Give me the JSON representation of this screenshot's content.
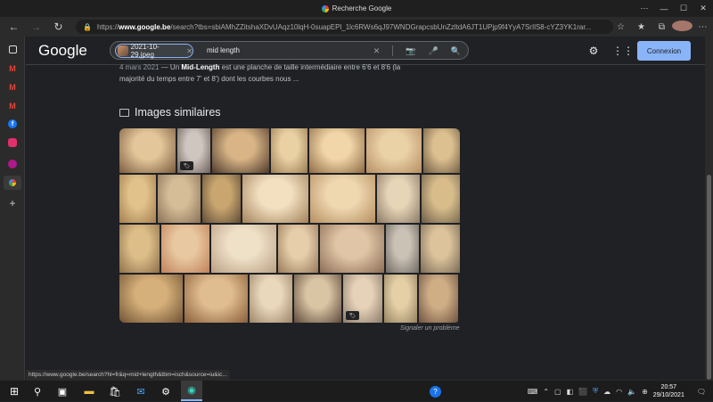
{
  "window": {
    "tab_title": "Recherche Google",
    "controls": [
      "—",
      "☐",
      "✕",
      "⋯"
    ]
  },
  "browser": {
    "url_prefix": "https://",
    "url_host": "www.google.be",
    "url_rest": "/search?tbs=sbiAMhZZitshaXDvUAqz10lqH-0suapEPl_1lc6RWs6qJ97WNDGrapcsbUnZzltdA6JT1UPjp9f4YyA7SrIlS8-cYZ3YK1rar..."
  },
  "google": {
    "logo": "Google",
    "chip_label": "2021-10-29.jpeg",
    "query": "mid length",
    "signin_label": "Connexion"
  },
  "result": {
    "date": "4 mars 2021",
    "sep": " — Un ",
    "bold": "Mid-Length",
    "text1": " est une planche de taille intermédiaire entre 6'6 et 8'6 (la",
    "text2": "majorité du temps entre 7' et 8') dont les courbes nous ..."
  },
  "similar": {
    "heading": "Images similaires",
    "report": "Signaler un problème"
  },
  "status_url": "https://www.google.be/search?hl=fr&q=mid+length&tbm=isch&source=iu&ic...",
  "clock": {
    "time": "20:57",
    "date": "29/10/2021"
  },
  "colors": {
    "accent": "#8ab4f8",
    "background": "#202124"
  },
  "images": [
    {
      "row": 0,
      "w": 63,
      "c1": "#e3c79a",
      "c2": "#7a5b3e",
      "badge": false
    },
    {
      "row": 0,
      "w": 37,
      "c1": "#cfc6bf",
      "c2": "#6e625b",
      "badge": true
    },
    {
      "row": 0,
      "w": 64,
      "c1": "#d8b486",
      "c2": "#4d3a2c",
      "badge": false
    },
    {
      "row": 0,
      "w": 41,
      "c1": "#e9d1a3",
      "c2": "#9b7d55",
      "badge": false
    },
    {
      "row": 0,
      "w": 62,
      "c1": "#f0d6a8",
      "c2": "#8f6a44",
      "badge": false
    },
    {
      "row": 0,
      "w": 62,
      "c1": "#ead1a6",
      "c2": "#b68e63",
      "badge": false
    },
    {
      "row": 0,
      "w": 43,
      "c1": "#dcc08f",
      "c2": "#6a5840",
      "badge": false
    },
    {
      "row": 1,
      "w": 41,
      "c1": "#e0c28a",
      "c2": "#a37d4f",
      "badge": false
    },
    {
      "row": 1,
      "w": 48,
      "c1": "#d5bd98",
      "c2": "#8a7157",
      "badge": false
    },
    {
      "row": 1,
      "w": 43,
      "c1": "#c9a66f",
      "c2": "#5e4b36",
      "badge": false
    },
    {
      "row": 1,
      "w": 74,
      "c1": "#f2e0c1",
      "c2": "#a4825b",
      "badge": false
    },
    {
      "row": 1,
      "w": 73,
      "c1": "#efd7b0",
      "c2": "#b48f60",
      "badge": false
    },
    {
      "row": 1,
      "w": 48,
      "c1": "#e7d5b8",
      "c2": "#8b7a66",
      "badge": false
    },
    {
      "row": 1,
      "w": 47,
      "c1": "#d8bd8b",
      "c2": "#6c5c48",
      "badge": false
    },
    {
      "row": 2,
      "w": 45,
      "c1": "#ddbe88",
      "c2": "#8d6f4b",
      "badge": false
    },
    {
      "row": 2,
      "w": 54,
      "c1": "#e8c8a0",
      "c2": "#c0805a",
      "badge": false
    },
    {
      "row": 2,
      "w": 73,
      "c1": "#efe0c8",
      "c2": "#b9a083",
      "badge": false
    },
    {
      "row": 2,
      "w": 45,
      "c1": "#e6ceaa",
      "c2": "#977a5a",
      "badge": false
    },
    {
      "row": 2,
      "w": 72,
      "c1": "#e0c6a6",
      "c2": "#8b6c55",
      "badge": false
    },
    {
      "row": 2,
      "w": 37,
      "c1": "#cbc2b6",
      "c2": "#6e6860",
      "badge": false
    },
    {
      "row": 2,
      "w": 44,
      "c1": "#dcc39b",
      "c2": "#7a6a55",
      "badge": false
    },
    {
      "row": 3,
      "w": 71,
      "c1": "#d6b07a",
      "c2": "#6f5234",
      "badge": false
    },
    {
      "row": 3,
      "w": 71,
      "c1": "#e0bd90",
      "c2": "#8a5e3a",
      "badge": false
    },
    {
      "row": 3,
      "w": 48,
      "c1": "#ead8bc",
      "c2": "#9d8568",
      "badge": false
    },
    {
      "row": 3,
      "w": 53,
      "c1": "#d9c4a4",
      "c2": "#5e4a3b",
      "badge": false
    },
    {
      "row": 3,
      "w": 44,
      "c1": "#e6d2b8",
      "c2": "#8b7b6a",
      "badge": true
    },
    {
      "row": 3,
      "w": 37,
      "c1": "#e4cfa6",
      "c2": "#93805f",
      "badge": false
    },
    {
      "row": 3,
      "w": 44,
      "c1": "#cfae86",
      "c2": "#6e5240",
      "badge": false
    }
  ]
}
